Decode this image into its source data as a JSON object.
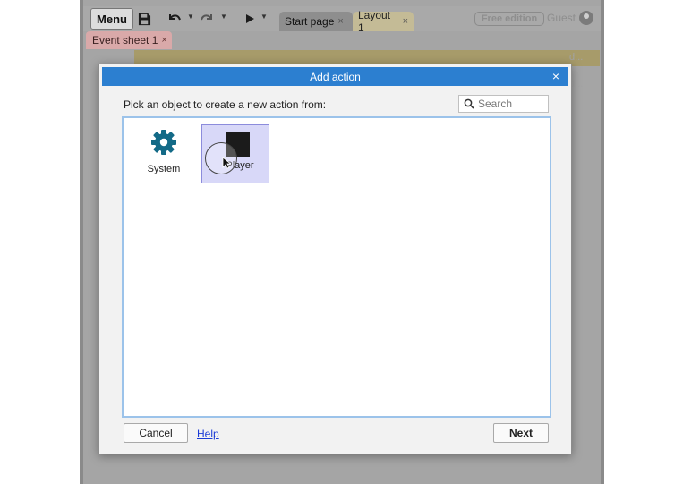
{
  "toolbar": {
    "menu_label": "Menu",
    "save_icon": "save-icon",
    "undo_icon": "undo-icon",
    "redo_icon": "redo-icon",
    "play_icon": "play-icon"
  },
  "tabs": [
    {
      "label": "Start page",
      "close": "×"
    },
    {
      "label": "Layout 1",
      "close": "×"
    }
  ],
  "account": {
    "edition_badge": "Free edition",
    "user_label": "Guest"
  },
  "sheet_tab": {
    "label": "Event sheet 1",
    "close": "×"
  },
  "background_hints": {
    "row1": "d...",
    "row2": "d..."
  },
  "dialog": {
    "title": "Add action",
    "close": "×",
    "prompt": "Pick an object to create a new action from:",
    "search_placeholder": "Search",
    "objects": [
      {
        "label": "System",
        "icon": "gear-icon"
      },
      {
        "label": "Player",
        "icon": "sprite-square-icon",
        "selected": true
      }
    ],
    "cancel_label": "Cancel",
    "help_label": "Help",
    "next_label": "Next"
  },
  "colors": {
    "titlebar": "#2c7fd0",
    "system_gear": "#136a87",
    "selection_bg": "#d8d8f8",
    "list_border": "#9cc3ea",
    "link": "#1a3bd6"
  }
}
